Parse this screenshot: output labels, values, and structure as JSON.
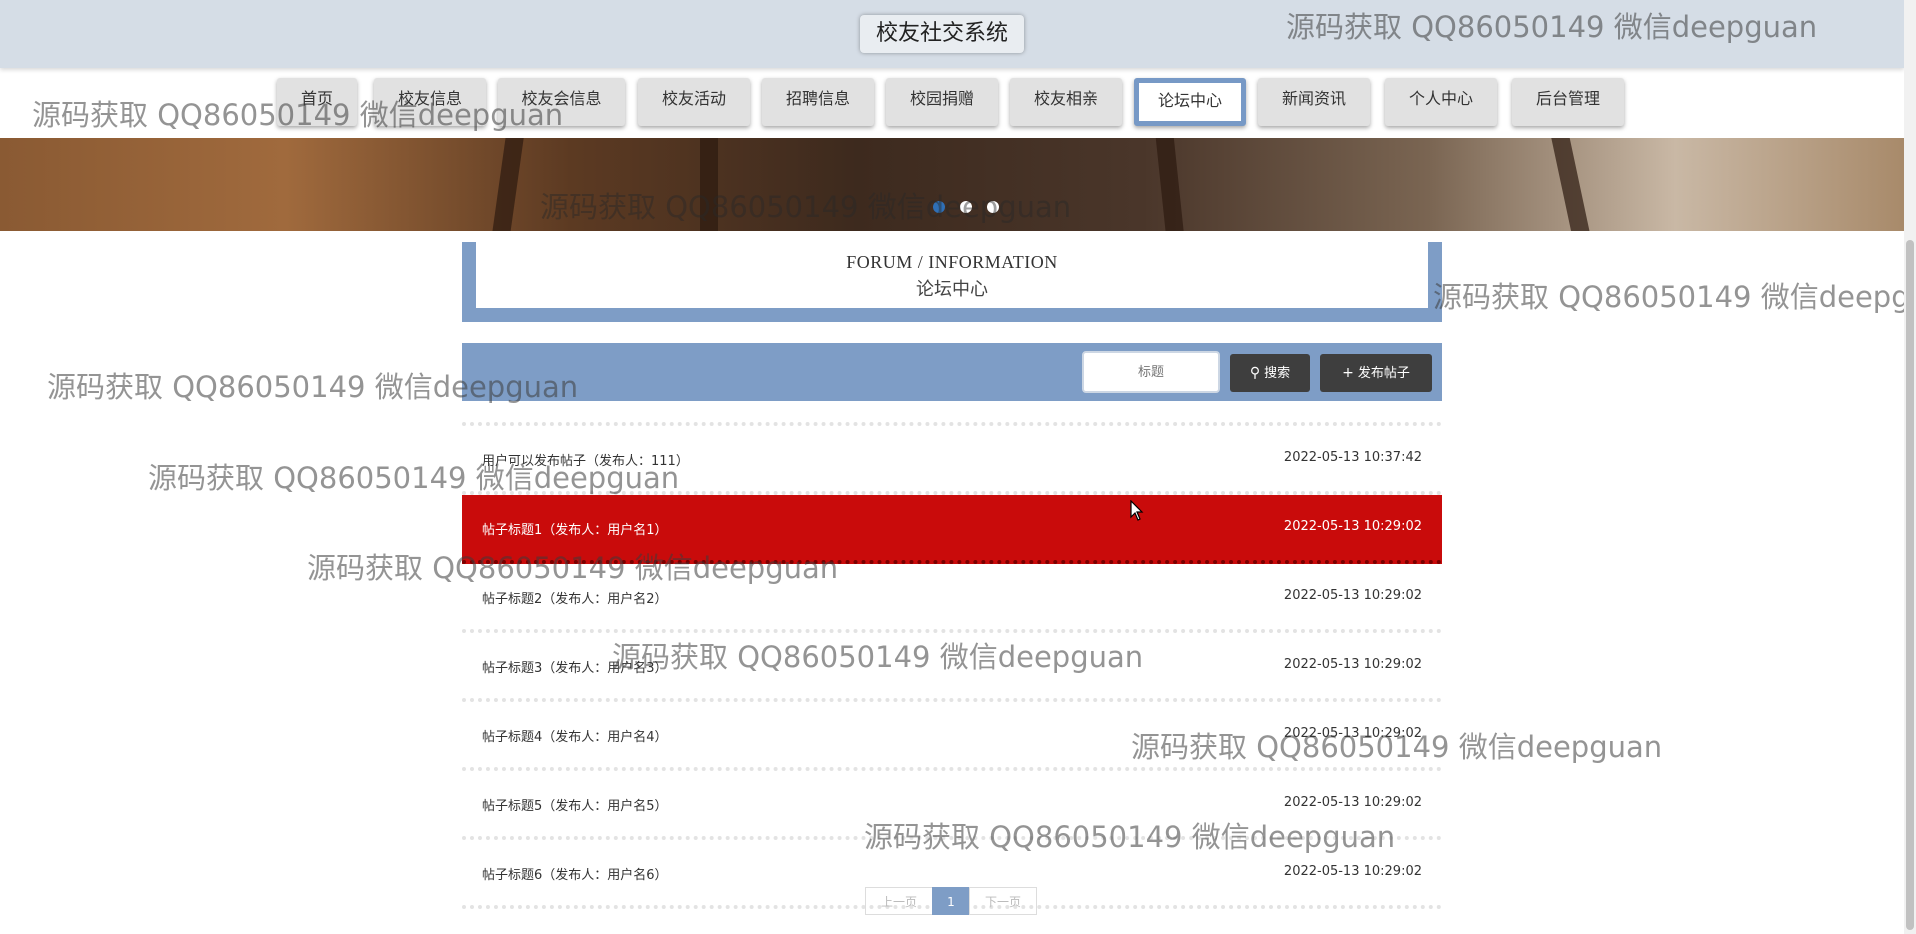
{
  "header": {
    "title": "校友社交系统"
  },
  "nav": {
    "items": [
      {
        "label": "首页"
      },
      {
        "label": "校友信息"
      },
      {
        "label": "校友会信息"
      },
      {
        "label": "校友活动"
      },
      {
        "label": "招聘信息"
      },
      {
        "label": "校园捐赠"
      },
      {
        "label": "校友相亲"
      },
      {
        "label": "论坛中心"
      },
      {
        "label": "新闻资讯"
      },
      {
        "label": "个人中心"
      },
      {
        "label": "后台管理"
      }
    ],
    "active": "论坛中心"
  },
  "section": {
    "title_en": "FORUM / INFORMATION",
    "title_cn": "论坛中心"
  },
  "search": {
    "placeholder": "标题",
    "search_label": "搜索",
    "post_label": "发布帖子"
  },
  "posts": [
    {
      "title": "用户可以发布帖子（发布人：111）",
      "date": "2022-05-13 10:37:42"
    },
    {
      "title": "帖子标题1（发布人：用户名1）",
      "date": "2022-05-13 10:29:02"
    },
    {
      "title": "帖子标题2（发布人：用户名2）",
      "date": "2022-05-13 10:29:02"
    },
    {
      "title": "帖子标题3（发布人：用户名3）",
      "date": "2022-05-13 10:29:02"
    },
    {
      "title": "帖子标题4（发布人：用户名4）",
      "date": "2022-05-13 10:29:02"
    },
    {
      "title": "帖子标题5（发布人：用户名5）",
      "date": "2022-05-13 10:29:02"
    },
    {
      "title": "帖子标题6（发布人：用户名6）",
      "date": "2022-05-13 10:29:02"
    }
  ],
  "pagination": {
    "prev": "上一页",
    "current": "1",
    "next": "下一页"
  },
  "watermark": "源码获取 QQ86050149 微信deepguan",
  "colors": {
    "accent": "#7e9dc6",
    "highlight": "#c90b0b",
    "header_bg": "#d5dde6"
  }
}
